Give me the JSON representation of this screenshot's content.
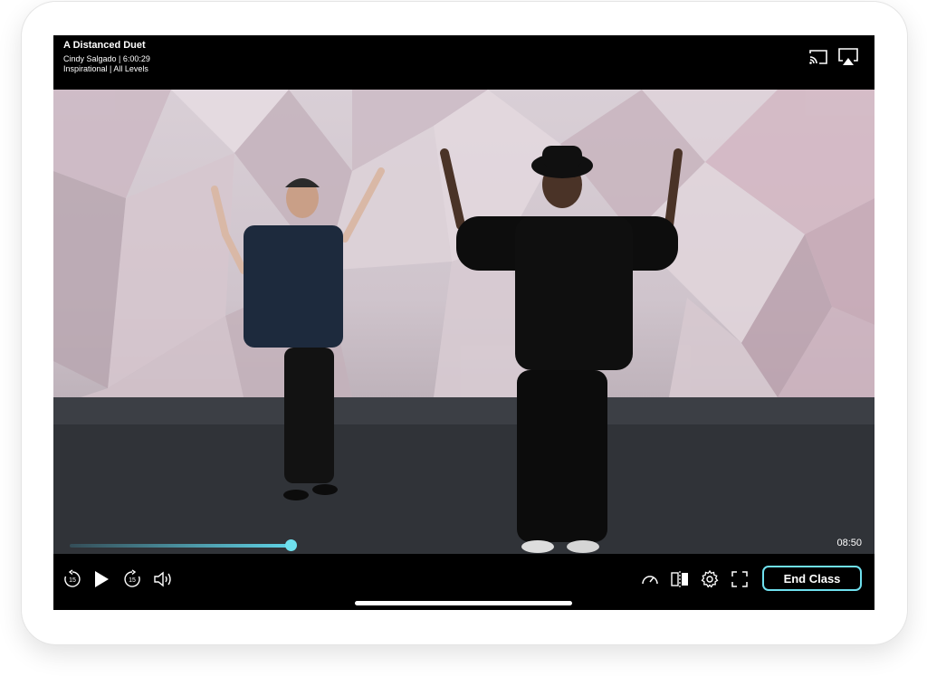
{
  "video": {
    "title": "A Distanced Duet",
    "instructor_duration": "Cindy Salgado | 6:00:29",
    "category_level": "Inspirational | All Levels",
    "timecode": "08:50",
    "progress_fraction": 0.28
  },
  "topbar_icons": [
    "cast-icon",
    "airplay-icon"
  ],
  "controls": {
    "rewind_label": "15",
    "forward_label": "15",
    "end_class_label": "End Class",
    "icons": [
      "rewind-15-icon",
      "play-icon",
      "forward-15-icon",
      "volume-icon",
      "speed-icon",
      "mirror-icon",
      "settings-icon",
      "fullscreen-icon"
    ]
  },
  "colors": {
    "accent": "#6fe0ee",
    "background": "#000000"
  }
}
